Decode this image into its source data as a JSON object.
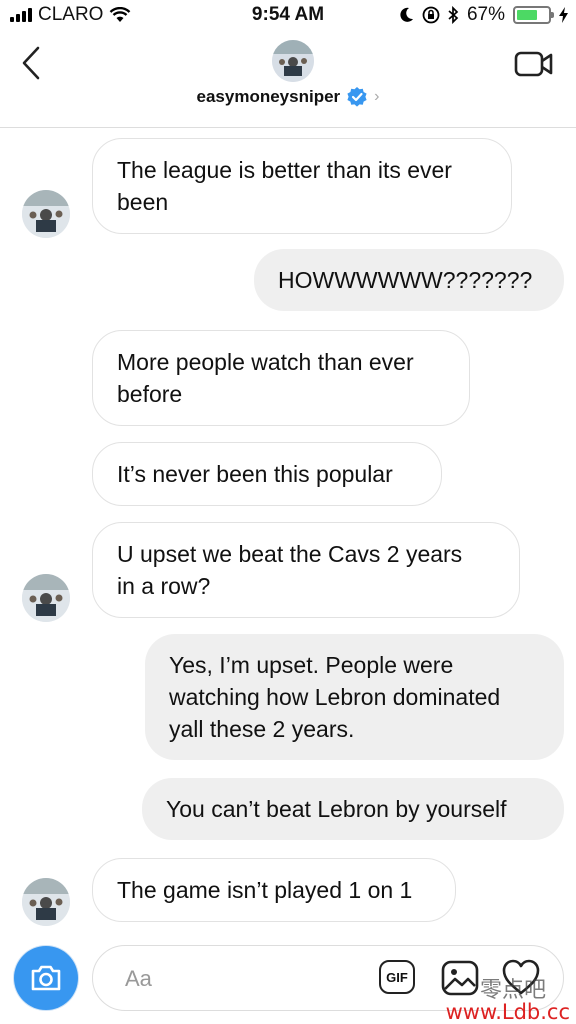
{
  "status_bar": {
    "carrier": "CLARO",
    "time": "9:54 AM",
    "battery": "67%",
    "battery_level": 0.67
  },
  "header": {
    "username": "easymoneysniper",
    "verified": true,
    "back_icon": "chevron-left-icon",
    "video_icon": "video-camera-icon"
  },
  "messages": [
    {
      "direction": "received",
      "text": "The league is better than its ever been",
      "lines": [
        "The league is better than its ever",
        "been"
      ]
    },
    {
      "direction": "sent",
      "text": "HOWWWWWW???????",
      "lines": [
        "HOWWWWWW???????"
      ]
    },
    {
      "direction": "received",
      "text": "More people watch than ever before",
      "lines": [
        "More people watch than ever",
        "before"
      ]
    },
    {
      "direction": "received",
      "text": "It’s never been this popular",
      "lines": [
        "It’s never been this popular"
      ]
    },
    {
      "direction": "received",
      "text": "U upset we beat the Cavs 2 years in a row?",
      "lines": [
        "U upset we beat the Cavs 2 years",
        "in a row?"
      ]
    },
    {
      "direction": "sent",
      "text": "Yes, I’m upset. People were watching how Lebron dominated yall these 2 years.",
      "lines": [
        "Yes, I’m upset. People were",
        "watching how Lebron dominated",
        "yall these 2 years."
      ]
    },
    {
      "direction": "sent",
      "text": "You can’t beat Lebron by yourself",
      "lines": [
        "You can’t beat Lebron by yourself"
      ]
    },
    {
      "direction": "received",
      "text": "The game isn’t played 1 on 1",
      "lines": [
        "The game isn’t played 1 on 1"
      ]
    }
  ],
  "composer": {
    "placeholder": "Aa",
    "gif_label": "GIF",
    "camera_icon": "camera-icon",
    "gallery_icon": "image-icon",
    "heart_icon": "heart-icon"
  },
  "watermark": {
    "chinese": "零点吧",
    "url": "www.Ldb.cc"
  },
  "colors": {
    "accent": "#3897f0",
    "battery": "#4cd964",
    "sent_bubble": "#efefef",
    "watermark_url": "#dd2222"
  }
}
